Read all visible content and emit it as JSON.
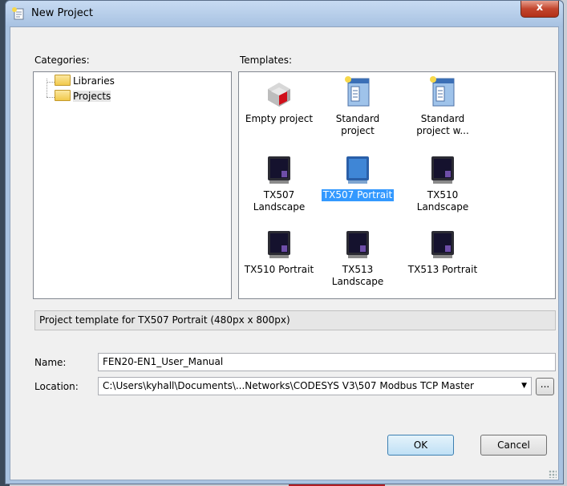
{
  "dialog": {
    "title": "New Project",
    "close_label": "x"
  },
  "categories": {
    "label": "Categories:",
    "items": [
      {
        "label": "Libraries",
        "icon": "folder-icon",
        "selected": false
      },
      {
        "label": "Projects",
        "icon": "folder-icon",
        "selected": true
      }
    ]
  },
  "templates": {
    "label": "Templates:",
    "items": [
      {
        "label": "Empty project",
        "icon": "empty-project-icon",
        "selected": false
      },
      {
        "label": "Standard project",
        "icon": "standard-project-icon",
        "selected": false
      },
      {
        "label": "Standard project w...",
        "icon": "standard-project-icon",
        "selected": false
      },
      {
        "label": "TX507 Landscape",
        "icon": "panel-device-icon",
        "selected": false
      },
      {
        "label": "TX507 Portrait",
        "icon": "panel-device-icon",
        "selected": true
      },
      {
        "label": "TX510 Landscape",
        "icon": "panel-device-icon",
        "selected": false
      },
      {
        "label": "TX510 Portrait",
        "icon": "panel-device-icon",
        "selected": false
      },
      {
        "label": "TX513 Landscape",
        "icon": "panel-device-icon",
        "selected": false
      },
      {
        "label": "TX513 Portrait",
        "icon": "panel-device-icon",
        "selected": false
      }
    ]
  },
  "description": "Project template for TX507 Portrait (480px x 800px)",
  "name": {
    "label": "Name:",
    "value": "FEN20-EN1_User_Manual"
  },
  "location": {
    "label": "Location:",
    "value": "C:\\Users\\kyhall\\Documents\\...Networks\\CODESYS V3\\507 Modbus TCP Master",
    "browse_label": "..."
  },
  "buttons": {
    "ok": "OK",
    "cancel": "Cancel"
  },
  "colors": {
    "selection": "#3399ff",
    "title_bar": "#b9d1ea",
    "close_button": "#c2452d"
  }
}
